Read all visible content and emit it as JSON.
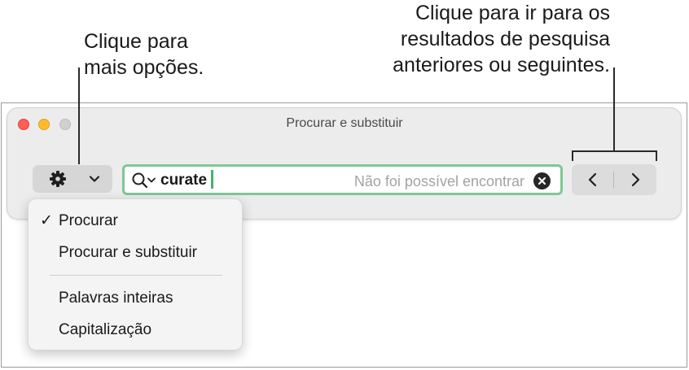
{
  "callouts": {
    "options": [
      "Clique para",
      "mais opções."
    ],
    "navigation": [
      "Clique para ir para os",
      "resultados de pesquisa",
      "anteriores ou seguintes."
    ]
  },
  "window": {
    "title": "Procurar e substituir",
    "traffic_lights": [
      "close",
      "minimize",
      "zoom"
    ]
  },
  "toolbar": {
    "options_button": {
      "icon": "gear-icon",
      "dropdown_icon": "chevron-down-icon"
    },
    "search": {
      "icon": "magnifier-icon",
      "value": "curate",
      "status": "Não foi possível encontrar",
      "clear_icon": "clear-circle-icon"
    },
    "navigation": {
      "previous_icon": "chevron-left-icon",
      "next_icon": "chevron-right-icon"
    }
  },
  "menu": {
    "items": [
      {
        "label": "Procurar",
        "checked": true,
        "check_mark": "✓"
      },
      {
        "label": "Procurar e substituir",
        "checked": false
      },
      {
        "label": "Palavras inteiras",
        "checked": false
      },
      {
        "label": "Capitalização",
        "checked": false
      }
    ]
  },
  "colors": {
    "search_focus_ring": "#7fc795",
    "caret": "#45b36b",
    "close": "#fe5f57",
    "minimize": "#febc2e",
    "zoom": "#d0d0d0"
  }
}
